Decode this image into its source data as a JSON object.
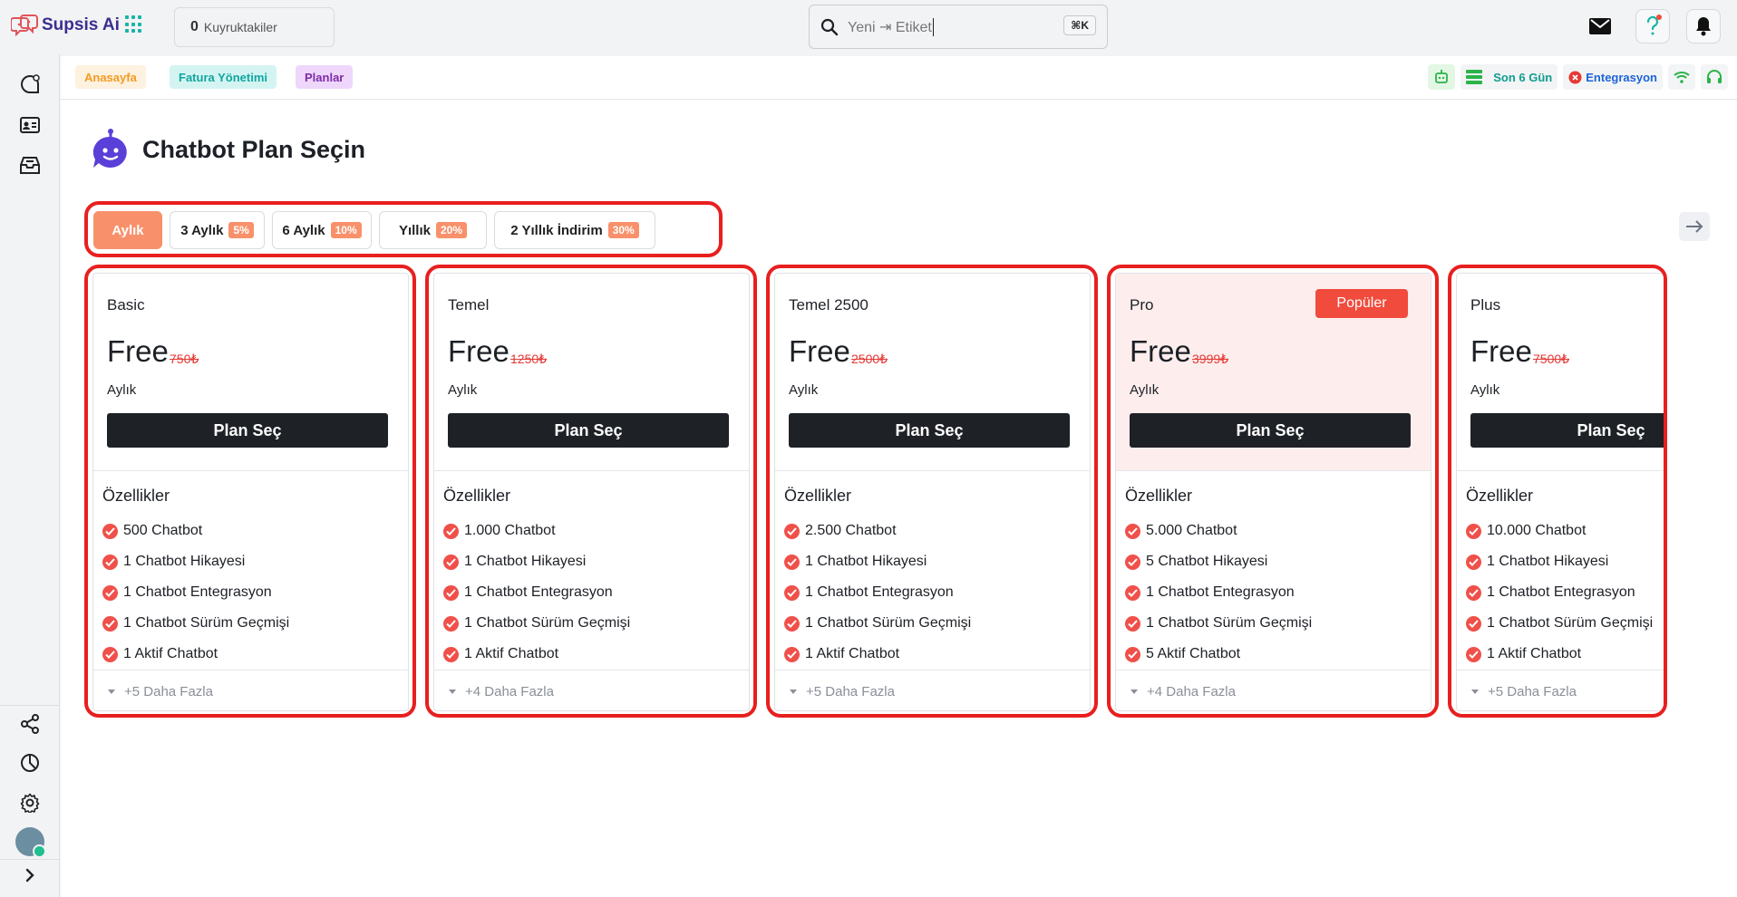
{
  "app": {
    "name": "Supsis Ai"
  },
  "topbar": {
    "queue_count": "0",
    "queue_label": "Kuyruktakiler",
    "search_text": "Yeni ⇥ Etiket",
    "search_shortcut": "⌘K"
  },
  "breadcrumbs": [
    {
      "label": "Anasayfa",
      "color": "#f59b22",
      "bg": "#fdf1df"
    },
    {
      "label": "Fatura Yönetimi",
      "color": "#11a6a0",
      "bg": "#d4f4f2"
    },
    {
      "label": "Planlar",
      "color": "#7d2ba8",
      "bg": "#eed7fb"
    }
  ],
  "status": {
    "range_label": "Son 6 Gün",
    "integration_label": "Entegrasyon"
  },
  "page": {
    "title": "Chatbot Plan Seçin"
  },
  "periods": [
    {
      "label": "Aylık",
      "discount": "",
      "active": true
    },
    {
      "label": "3 Aylık",
      "discount": "5%"
    },
    {
      "label": "6 Aylık",
      "discount": "10%"
    },
    {
      "label": "Yıllık",
      "discount": "20%"
    },
    {
      "label": "2 Yıllık İndirim",
      "discount": "30%"
    }
  ],
  "plans": [
    {
      "name": "Basic",
      "price": "Free",
      "old_price": "750₺",
      "period": "Aylık",
      "button": "Plan Seç",
      "features_title": "Özellikler",
      "features": [
        "500 Chatbot",
        "1 Chatbot Hikayesi",
        "1 Chatbot Entegrasyon",
        "1 Chatbot Sürüm Geçmişi",
        "1 Aktif Chatbot"
      ],
      "more": "+5 Daha Fazla"
    },
    {
      "name": "Temel",
      "price": "Free",
      "old_price": "1250₺",
      "period": "Aylık",
      "button": "Plan Seç",
      "features_title": "Özellikler",
      "features": [
        "1.000 Chatbot",
        "1 Chatbot Hikayesi",
        "1 Chatbot Entegrasyon",
        "1 Chatbot Sürüm Geçmişi",
        "1 Aktif Chatbot"
      ],
      "more": "+4 Daha Fazla"
    },
    {
      "name": "Temel 2500",
      "price": "Free",
      "old_price": "2500₺",
      "period": "Aylık",
      "button": "Plan Seç",
      "features_title": "Özellikler",
      "features": [
        "2.500 Chatbot",
        "1 Chatbot Hikayesi",
        "1 Chatbot Entegrasyon",
        "1 Chatbot Sürüm Geçmişi",
        "1 Aktif Chatbot"
      ],
      "more": "+5 Daha Fazla"
    },
    {
      "name": "Pro",
      "badge": "Popüler",
      "price": "Free",
      "old_price": "3999₺",
      "period": "Aylık",
      "button": "Plan Seç",
      "features_title": "Özellikler",
      "features": [
        "5.000 Chatbot",
        "5 Chatbot Hikayesi",
        "1 Chatbot Entegrasyon",
        "1 Chatbot Sürüm Geçmişi",
        "5 Aktif Chatbot"
      ],
      "more": "+4 Daha Fazla"
    },
    {
      "name": "Plus",
      "price": "Free",
      "old_price": "7500₺",
      "period": "Aylık",
      "button": "Plan Seç",
      "features_title": "Özellikler",
      "features": [
        "10.000 Chatbot",
        "1 Chatbot Hikayesi",
        "1 Chatbot Entegrasyon",
        "1 Chatbot Sürüm Geçmişi",
        "1 Aktif Chatbot"
      ],
      "more": "+5 Daha Fazla"
    }
  ]
}
